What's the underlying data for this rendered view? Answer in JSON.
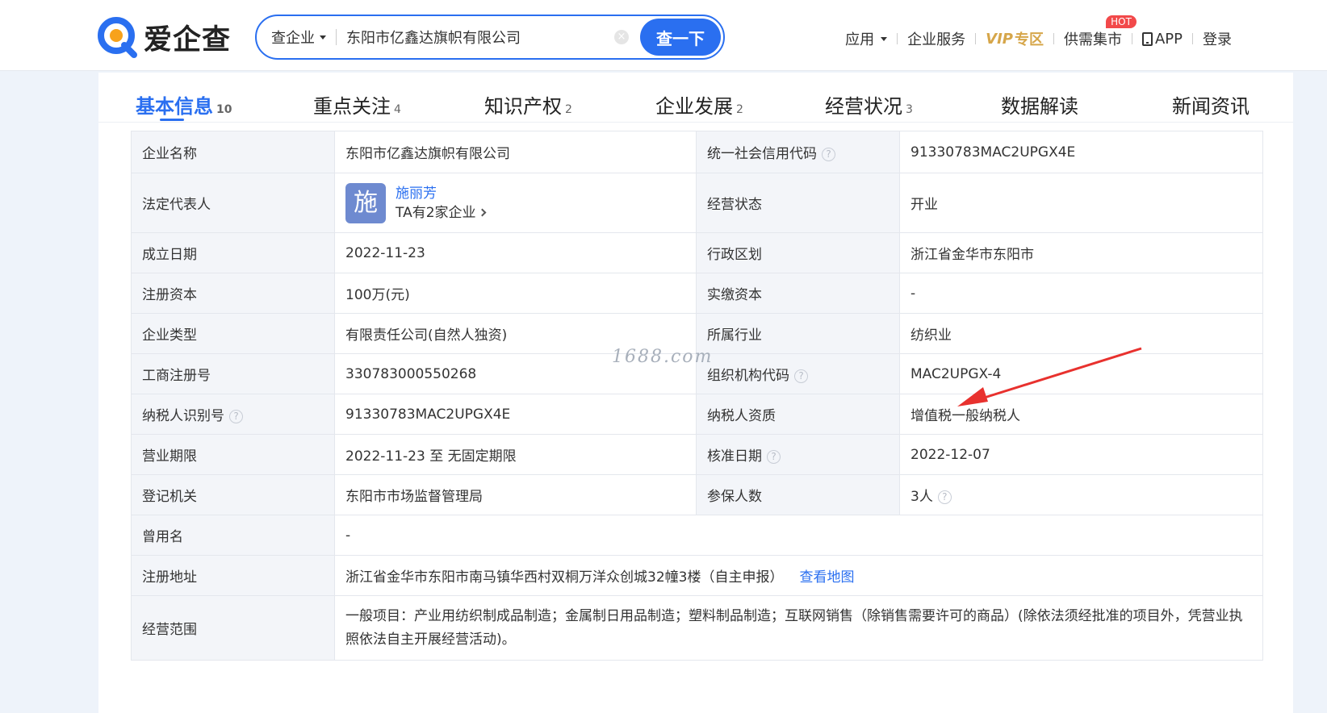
{
  "header": {
    "logo_text": "爱企查",
    "search": {
      "type_label": "查企业",
      "value": "东阳市亿鑫达旗帜有限公司",
      "clear": "×",
      "button": "查一下"
    },
    "nav": {
      "apps": "应用",
      "services": "企业服务",
      "vip": "VIP",
      "vip_sub": "专区",
      "market": "供需集市",
      "hot": "HOT",
      "app": "APP",
      "login": "登录"
    }
  },
  "tabs": [
    {
      "label": "基本信息",
      "count": "10"
    },
    {
      "label": "重点关注",
      "count": "4"
    },
    {
      "label": "知识产权",
      "count": "2"
    },
    {
      "label": "企业发展",
      "count": "2"
    },
    {
      "label": "经营状况",
      "count": "3"
    },
    {
      "label": "数据解读",
      "count": ""
    },
    {
      "label": "新闻资讯",
      "count": ""
    }
  ],
  "info": {
    "company_name_k": "企业名称",
    "company_name_v": "东阳市亿鑫达旗帜有限公司",
    "credit_code_k": "统一社会信用代码",
    "credit_code_v": "91330783MAC2UPGX4E",
    "legal_rep_k": "法定代表人",
    "legal_rep_avatar": "施",
    "legal_rep_name": "施丽芳",
    "legal_rep_more": "TA有2家企业",
    "status_k": "经营状态",
    "status_v": "开业",
    "founded_k": "成立日期",
    "founded_v": "2022-11-23",
    "region_k": "行政区划",
    "region_v": "浙江省金华市东阳市",
    "capital_k": "注册资本",
    "capital_v": "100万(元)",
    "paid_capital_k": "实缴资本",
    "paid_capital_v": "-",
    "type_k": "企业类型",
    "type_v": "有限责任公司(自然人独资)",
    "industry_k": "所属行业",
    "industry_v": "纺织业",
    "reg_no_k": "工商注册号",
    "reg_no_v": "330783000550268",
    "org_code_k": "组织机构代码",
    "org_code_v": "MAC2UPGX-4",
    "taxpayer_id_k": "纳税人识别号",
    "taxpayer_id_v": "91330783MAC2UPGX4E",
    "taxpayer_qual_k": "纳税人资质",
    "taxpayer_qual_v": "增值税一般纳税人",
    "period_k": "营业期限",
    "period_v": "2022-11-23 至 无固定期限",
    "approved_k": "核准日期",
    "approved_v": "2022-12-07",
    "authority_k": "登记机关",
    "authority_v": "东阳市市场监督管理局",
    "insured_k": "参保人数",
    "insured_v": "3人",
    "former_name_k": "曾用名",
    "former_name_v": "-",
    "address_k": "注册地址",
    "address_v": "浙江省金华市东阳市南马镇华西村双桐万洋众创城32幢3楼（自主申报）",
    "map_link": "查看地图",
    "scope_k": "经营范围",
    "scope_v": "一般项目：产业用纺织制成品制造；金属制日用品制造；塑料制品制造；互联网销售（除销售需要许可的商品）(除依法须经批准的项目外，凭营业执照依法自主开展经营活动)。"
  },
  "watermark": "1688.com",
  "help_glyph": "?",
  "colors": {
    "accent": "#2a6ff0",
    "vip": "#d6a64a",
    "hot": "#f2494a",
    "annotation_arrow": "#e8312e"
  }
}
